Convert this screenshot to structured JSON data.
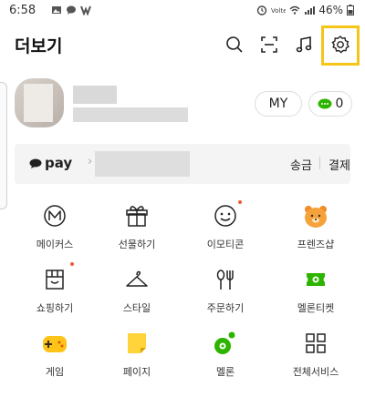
{
  "status_bar": {
    "time": "6:58",
    "battery": "46%"
  },
  "header": {
    "title": "더보기"
  },
  "profile": {
    "my_label": "MY",
    "chat_count": "0"
  },
  "pay": {
    "logo_text": "pay",
    "send_label": "송금",
    "payment_label": "결제"
  },
  "services": [
    {
      "label": "메이커스",
      "icon": "makers-icon"
    },
    {
      "label": "선물하기",
      "icon": "gift-icon"
    },
    {
      "label": "이모티콘",
      "icon": "emoticon-icon",
      "badge": true
    },
    {
      "label": "프렌즈샵",
      "icon": "friends-shop-icon"
    },
    {
      "label": "쇼핑하기",
      "icon": "shopping-icon",
      "badge": true
    },
    {
      "label": "스타일",
      "icon": "style-icon"
    },
    {
      "label": "주문하기",
      "icon": "order-icon"
    },
    {
      "label": "멜론티켓",
      "icon": "melon-ticket-icon"
    },
    {
      "label": "게임",
      "icon": "game-icon"
    },
    {
      "label": "페이지",
      "icon": "page-icon"
    },
    {
      "label": "멜론",
      "icon": "melon-icon"
    },
    {
      "label": "전체서비스",
      "icon": "all-services-icon"
    }
  ],
  "colors": {
    "highlight": "#f5c518",
    "badge": "#f05a3a",
    "melon_green": "#2db400",
    "kakao_yellow": "#fee500"
  }
}
